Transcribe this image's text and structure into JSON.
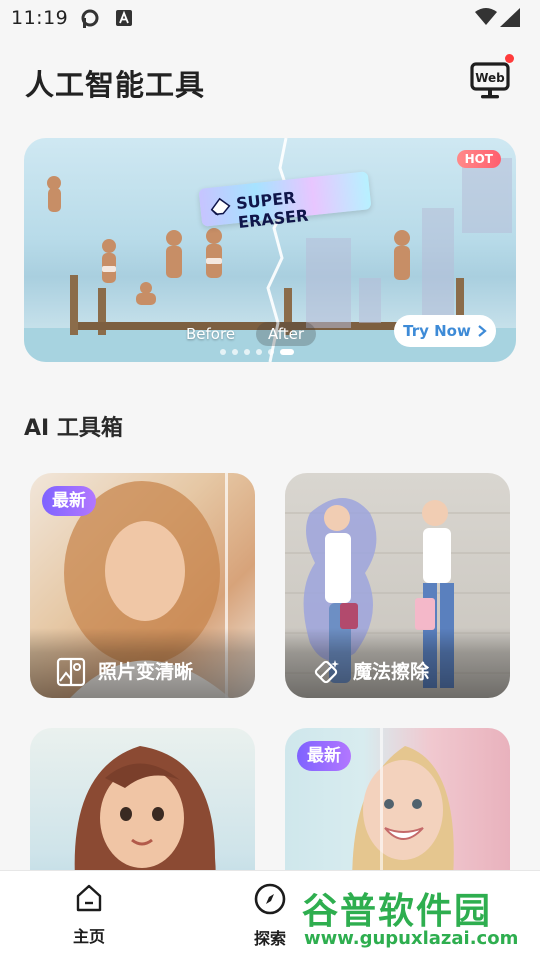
{
  "status": {
    "time": "11:19"
  },
  "header": {
    "title": "人工智能工具",
    "web_label": "Web"
  },
  "banner": {
    "hot": "HOT",
    "tag": "SUPER ERASER",
    "before": "Before",
    "after": "After",
    "cta": "Try Now",
    "dots": 6,
    "active_dot": 5
  },
  "section": {
    "title": "AI 工具箱"
  },
  "tools": [
    {
      "label": "照片变清晰",
      "badge": "最新",
      "icon": "image-enhance-icon"
    },
    {
      "label": "魔法擦除",
      "badge": "",
      "icon": "magic-eraser-icon"
    },
    {
      "label": "",
      "badge": "",
      "icon": ""
    },
    {
      "label": "",
      "badge": "最新",
      "icon": ""
    }
  ],
  "nav": {
    "home": "主页",
    "explore": "探索"
  },
  "watermark": {
    "title": "谷普软件园",
    "url": "www.gupuxlazai.com"
  },
  "colors": {
    "accent": "#3e8bd7",
    "badge_start": "#7f63ff",
    "badge_end": "#b277ff",
    "hot": "#ff5e6e",
    "watermark": "#2eae4f"
  }
}
